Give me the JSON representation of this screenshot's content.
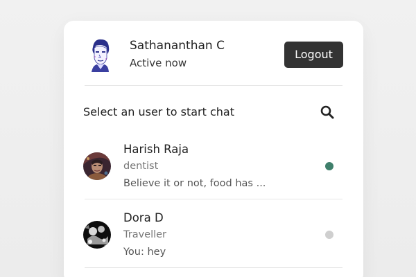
{
  "current_user": {
    "name": "Sathananthan C",
    "status": "Active now"
  },
  "header": {
    "logout_label": "Logout"
  },
  "search": {
    "label": "Select an user to start chat",
    "icon": "search-icon"
  },
  "users": [
    {
      "name": "Harish Raja",
      "about": "dentist",
      "last_message": "Believe it or not, food has ...",
      "status": "online",
      "status_color": "#3f7f6b"
    },
    {
      "name": "Dora D",
      "about": "Traveller",
      "last_message": "You: hey",
      "status": "offline",
      "status_color": "#cfcfcf"
    }
  ],
  "colors": {
    "button": "#333333",
    "online": "#3f7f6b",
    "offline": "#cfcfcf"
  }
}
